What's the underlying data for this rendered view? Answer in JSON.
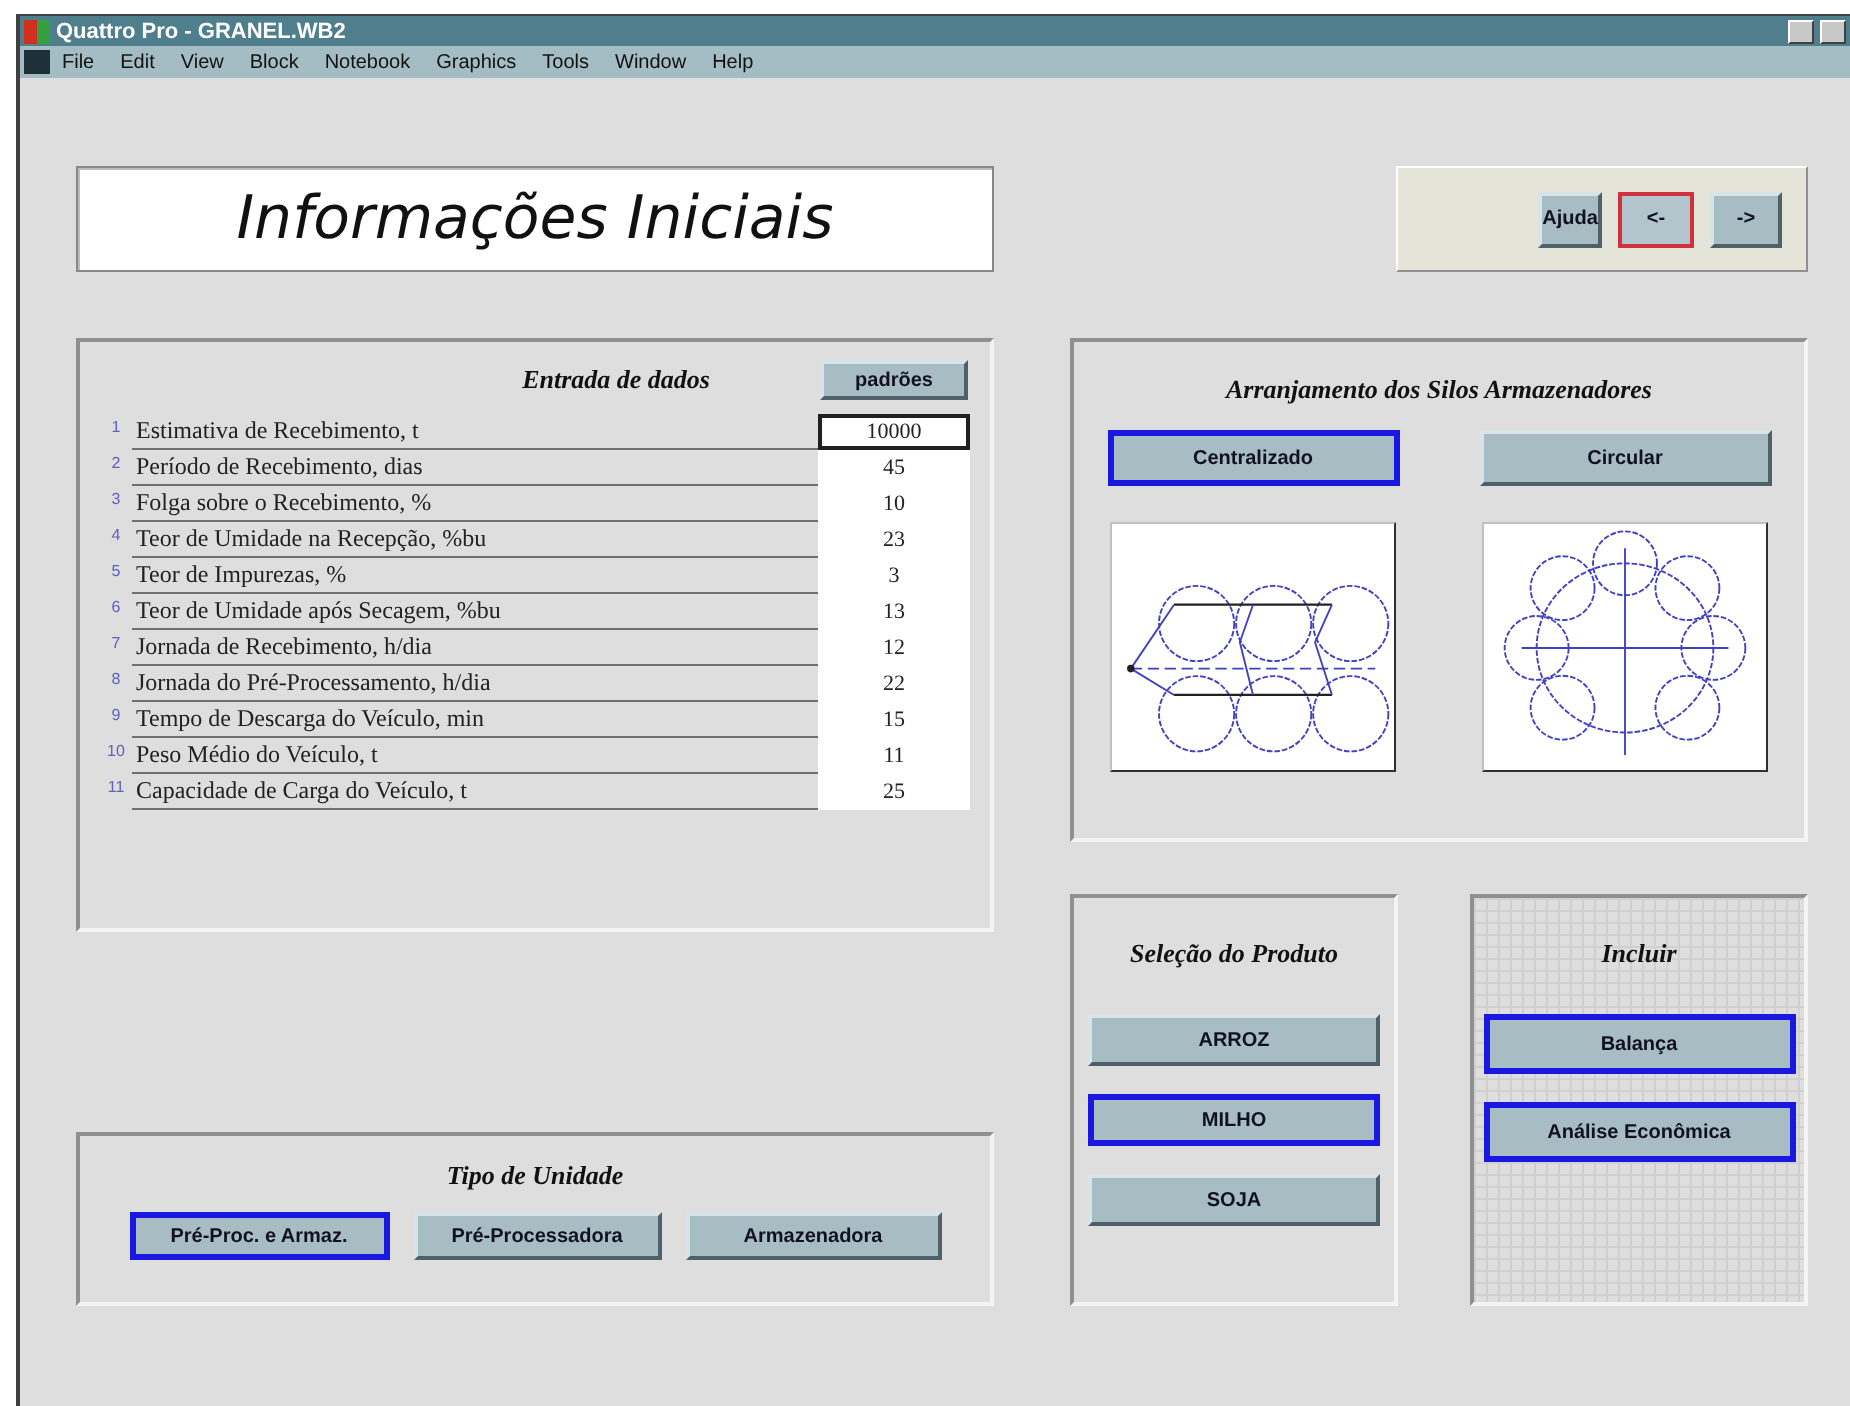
{
  "window": {
    "title": "Quattro Pro - GRANEL.WB2"
  },
  "menu": [
    "File",
    "Edit",
    "View",
    "Block",
    "Notebook",
    "Graphics",
    "Tools",
    "Window",
    "Help"
  ],
  "header": {
    "title": "Informações Iniciais"
  },
  "nav_buttons": [
    {
      "label": "Ajuda",
      "highlighted": false
    },
    {
      "label": "<-",
      "highlighted": true
    },
    {
      "label": "->",
      "highlighted": false
    }
  ],
  "data_entry": {
    "title": "Entrada de dados",
    "defaults_button": "padrões",
    "rows": [
      {
        "number": "1",
        "label": "Estimativa de Recebimento, t",
        "value": "10000",
        "selected": true
      },
      {
        "number": "2",
        "label": "Período de Recebimento, dias",
        "value": "45",
        "selected": false
      },
      {
        "number": "3",
        "label": "Folga sobre o Recebimento, %",
        "value": "10",
        "selected": false
      },
      {
        "number": "4",
        "label": "Teor de Umidade na Recepção, %bu",
        "value": "23",
        "selected": false
      },
      {
        "number": "5",
        "label": "Teor de Impurezas, %",
        "value": "3",
        "selected": false
      },
      {
        "number": "6",
        "label": "Teor de Umidade após Secagem, %bu",
        "value": "13",
        "selected": false
      },
      {
        "number": "7",
        "label": "Jornada de Recebimento, h/dia",
        "value": "12",
        "selected": false
      },
      {
        "number": "8",
        "label": "Jornada do Pré-Processamento, h/dia",
        "value": "22",
        "selected": false
      },
      {
        "number": "9",
        "label": "Tempo de Descarga do Veículo, min",
        "value": "15",
        "selected": false
      },
      {
        "number": "10",
        "label": "Peso Médio do Veículo, t",
        "value": "11",
        "selected": false
      },
      {
        "number": "11",
        "label": "Capacidade de Carga do Veículo, t",
        "value": "25",
        "selected": false
      }
    ]
  },
  "silo_arrangement": {
    "title": "Arranjamento dos Silos Armazenadores",
    "options": [
      {
        "label": "Centralizado",
        "selected": true,
        "kind": "centralized"
      },
      {
        "label": "Circular",
        "selected": false,
        "kind": "circular"
      }
    ]
  },
  "unit_type": {
    "title": "Tipo de Unidade",
    "options": [
      {
        "label": "Pré-Proc. e Armaz.",
        "selected": true
      },
      {
        "label": "Pré-Processadora",
        "selected": false
      },
      {
        "label": "Armazenadora",
        "selected": false
      }
    ]
  },
  "product": {
    "title": "Seleção do Produto",
    "options": [
      {
        "label": "ARROZ",
        "selected": false
      },
      {
        "label": "MILHO",
        "selected": true
      },
      {
        "label": "SOJA",
        "selected": false
      }
    ]
  },
  "include": {
    "title": "Incluir",
    "options": [
      {
        "label": "Balança",
        "selected": true
      },
      {
        "label": "Análise Econômica",
        "selected": true
      }
    ]
  }
}
